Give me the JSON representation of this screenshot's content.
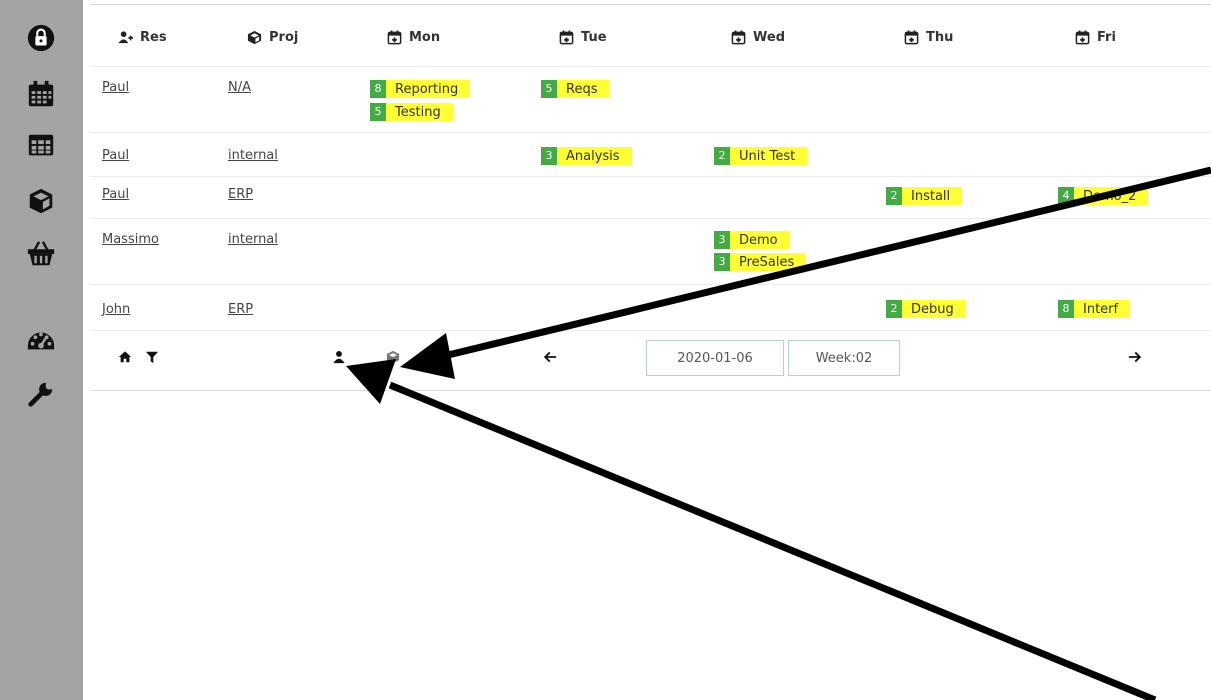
{
  "sidebar": {
    "items": [
      {
        "icon": "lock-icon"
      },
      {
        "icon": "calendar-icon"
      },
      {
        "icon": "table-icon"
      },
      {
        "icon": "cube-icon"
      },
      {
        "icon": "basket-icon"
      },
      {
        "icon": "dashboard-icon"
      },
      {
        "icon": "wrench-icon"
      }
    ]
  },
  "header": {
    "res": "Res",
    "proj": "Proj",
    "days": [
      "Mon",
      "Tue",
      "Wed",
      "Thu",
      "Fri"
    ]
  },
  "rows": [
    {
      "resource": "Paul",
      "project": "N/A",
      "tasks": [
        {
          "day": "Mon",
          "hours": "8",
          "label": "Reporting"
        },
        {
          "day": "Mon",
          "hours": "5",
          "label": "Testing"
        },
        {
          "day": "Tue",
          "hours": "5",
          "label": "Reqs"
        }
      ]
    },
    {
      "resource": "Paul",
      "project": "internal",
      "tasks": [
        {
          "day": "Tue",
          "hours": "3",
          "label": "Analysis"
        },
        {
          "day": "Wed",
          "hours": "2",
          "label": "Unit Test"
        }
      ]
    },
    {
      "resource": "Paul",
      "project": "ERP",
      "tasks": [
        {
          "day": "Thu",
          "hours": "2",
          "label": "Install"
        },
        {
          "day": "Fri",
          "hours": "4",
          "label": "Demo_2"
        }
      ]
    },
    {
      "resource": "Massimo",
      "project": "internal",
      "tasks": [
        {
          "day": "Wed",
          "hours": "3",
          "label": "Demo"
        },
        {
          "day": "Wed",
          "hours": "3",
          "label": "PreSales"
        }
      ]
    },
    {
      "resource": "John",
      "project": "ERP",
      "tasks": [
        {
          "day": "Thu",
          "hours": "2",
          "label": "Debug"
        },
        {
          "day": "Fri",
          "hours": "8",
          "label": "Interf"
        }
      ]
    }
  ],
  "toolbar": {
    "date": "2020-01-06",
    "week": "Week:02"
  },
  "colors": {
    "sidebar": "#a4a4a4",
    "task_bg": "#ffff33",
    "badge_bg": "#44aa44"
  }
}
